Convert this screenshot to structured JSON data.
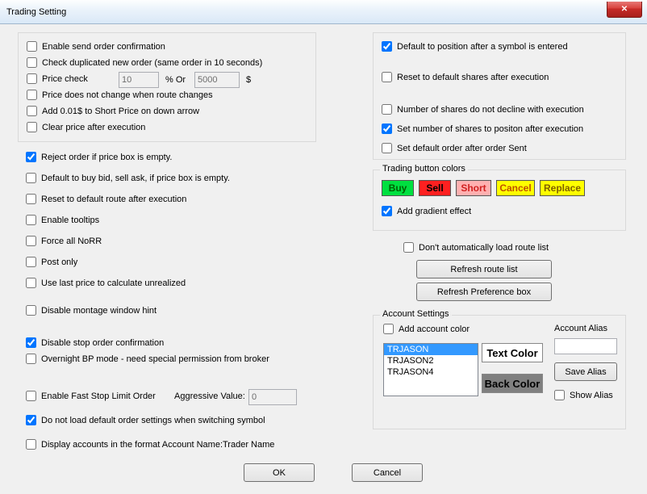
{
  "window": {
    "title": "Trading Setting",
    "close_glyph": "✕"
  },
  "left_box": {
    "enable_send_order_confirm": "Enable send order confirmation",
    "check_dup": "Check duplicated new order (same order in 10 seconds)",
    "price_check": "Price check",
    "price_check_val": "10",
    "pct_or": "%  Or",
    "price_check_val2": "5000",
    "dollar": "$",
    "price_no_change_route": "Price does not change when route changes",
    "add_001": "Add 0.01$ to Short Price on down arrow",
    "clear_price": "Clear price after execution"
  },
  "left_col": {
    "reject_empty": "Reject order if price box is empty.",
    "default_buy_bid": "Default to buy bid, sell ask, if price box is empty.",
    "reset_route": "Reset to default route after execution",
    "enable_tooltips": "Enable tooltips",
    "force_norr": "Force all NoRR",
    "post_only": "Post only",
    "use_last_price": "Use last price to calculate unrealized",
    "disable_montage_hint": "Disable montage window hint",
    "disable_stop_confirm": "Disable stop order confirmation",
    "overnight_bp": "Overnight BP mode - need special permission from broker",
    "enable_fast_stop": "Enable Fast Stop Limit Order",
    "aggressive_label": "Aggressive Value:",
    "aggressive_val": "0",
    "do_not_load_default": "Do not load default order settings when switching symbol",
    "display_accounts_fmt": "Display accounts in the format Account Name:Trader Name"
  },
  "right_col": {
    "default_position": "Default to position after a symbol is entered",
    "reset_default_shares": "Reset to default shares after execution",
    "num_shares_no_decline": "Number of shares do not decline with execution",
    "set_shares_position": "Set number of shares to positon after execution",
    "set_default_after_sent": "Set default order after order Sent"
  },
  "colors_box": {
    "legend": "Trading button colors",
    "buy": "Buy",
    "sell": "Sell",
    "short": "Short",
    "cancel": "Cancel",
    "replace": "Replace",
    "add_gradient": "Add gradient effect",
    "colors": {
      "buy_bg": "#00e040",
      "buy_fg": "#006000",
      "sell_bg": "#ff2020",
      "sell_fg": "#000000",
      "short_bg": "#ffb0b0",
      "short_fg": "#d02020",
      "cancel_bg": "#ffff00",
      "cancel_fg": "#c05000",
      "replace_bg": "#ffff00",
      "replace_fg": "#806000"
    }
  },
  "route_box": {
    "dont_auto_load": "Don't automatically load route list",
    "refresh_route": "Refresh route list",
    "refresh_pref": "Refresh Preference box"
  },
  "acct_box": {
    "legend": "Account Settings",
    "add_account_color": "Add account color",
    "accounts": [
      "TRJASON",
      "TRJASON2",
      "TRJASON4"
    ],
    "text_color": "Text Color",
    "back_color": "Back Color",
    "account_alias": "Account Alias",
    "save_alias": "Save Alias",
    "show_alias": "Show Alias"
  },
  "buttons": {
    "ok": "OK",
    "cancel": "Cancel"
  }
}
